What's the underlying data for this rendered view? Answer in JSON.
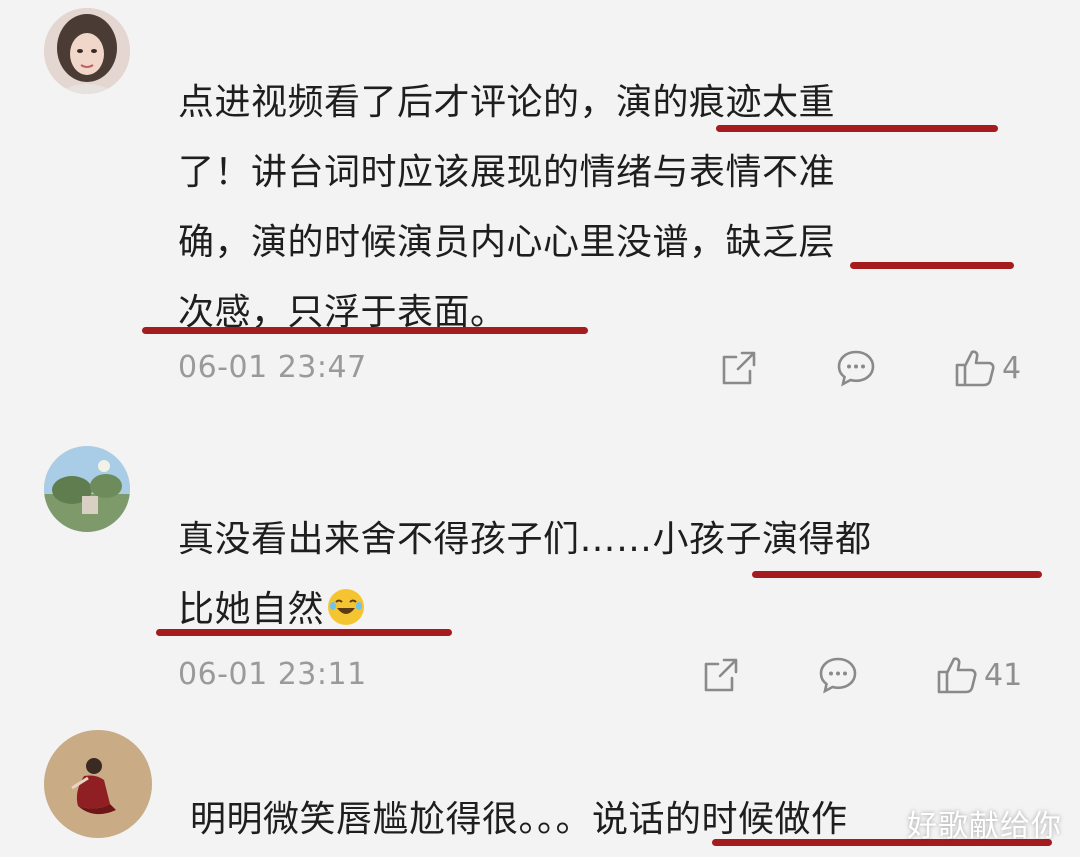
{
  "colors": {
    "background": "#f3f3f3",
    "text": "#1e1e1e",
    "meta": "#9a9a9a",
    "underline": "#a51c1f"
  },
  "comments": [
    {
      "lines": [
        {
          "plain": "点进视频看了后才评论的，",
          "highlight": "演的痕迹太重"
        },
        {
          "plain": "了！讲台词时应该展现的情绪与表情不准"
        },
        {
          "plain": "确，演的时候演员内心心里没谱，",
          "highlight": "缺乏层"
        },
        {
          "highlight": "次感，只浮于表面。"
        }
      ],
      "time": "06-01 23:47",
      "likes": "4"
    },
    {
      "lines": [
        {
          "plain": "真没看出来舍不得孩子们……",
          "highlight": "小孩子演得都"
        },
        {
          "highlight": "比她自然"
        }
      ],
      "emoji": "laughing-crying-emoji",
      "time": "06-01 23:11",
      "likes": "41"
    },
    {
      "lines": [
        {
          "plain": "明明微笑唇尴尬得很。。。",
          "highlight": "说话的时候做作"
        }
      ]
    }
  ],
  "icons": {
    "share": "share-icon",
    "comment": "comment-icon",
    "like": "thumbs-up-icon"
  },
  "watermark": "好歌献给你"
}
